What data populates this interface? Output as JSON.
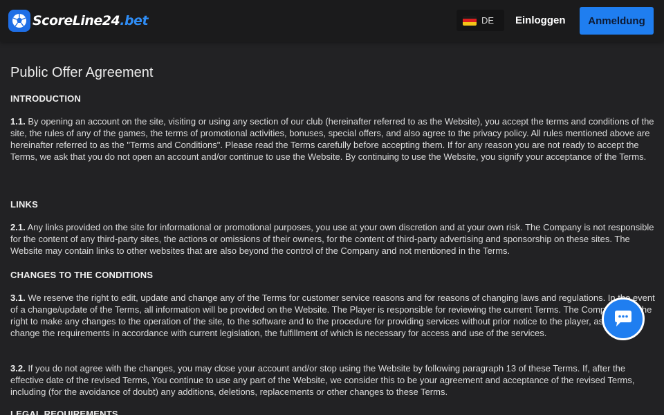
{
  "header": {
    "logo_text_main": "ScoreLine24",
    "logo_text_suffix": ".bet",
    "language_code": "DE",
    "login_label": "Einloggen",
    "register_label": "Anmeldung"
  },
  "colors": {
    "accent": "#1f7ef0",
    "background": "#222224",
    "header_background": "#1b1b1c"
  },
  "icons": {
    "logo": "soccer-ball-logo-icon",
    "flag": "germany-flag-icon",
    "chat": "chat-bubble-icon"
  },
  "main": {
    "title": "Public Offer Agreement",
    "sections": [
      {
        "heading": "INTRODUCTION",
        "paragraphs": [
          {
            "number": "1.1.",
            "text": "By opening an account on the site, visiting or using any section of our club (hereinafter referred to as the Website), you accept the terms and conditions of the site, the rules of any of the games, the terms of promotional activities, bonuses, special offers, and also agree to the privacy policy. All rules mentioned above are hereinafter referred to as the \"Terms and Conditions\". Please read the Terms carefully before accepting them. If for any reason you are not ready to accept the Terms, we ask that you do not open an account and/or continue to use the Website. By continuing to use the Website, you signify your acceptance of the Terms."
          }
        ]
      },
      {
        "heading": "LINKS",
        "paragraphs": [
          {
            "number": "2.1.",
            "text": "Any links provided on the site for informational or promotional purposes, you use at your own discretion and at your own risk. The Company is not responsible for the content of any third-party sites, the actions or omissions of their owners, for the content of third-party advertising and sponsorship on these sites. The Website may contain links to other websites that are also beyond the control of the Company and not mentioned in the Terms."
          }
        ]
      },
      {
        "heading": "CHANGES TO THE CONDITIONS",
        "paragraphs": [
          {
            "number": "3.1.",
            "text": "We reserve the right to edit, update and change any of the Terms for customer service reasons and for reasons of changing laws and regulations. In the event of a change/update of the Terms, all information will be provided on the Website. The Player is responsible for reviewing the current Terms. The Company has the right to make any changes to the operation of the site, to the software and to the procedure for providing services without prior notice to the player, as well as to change the requirements in accordance with current legislation, the fulfillment of which is necessary for access and use of the services."
          },
          {
            "number": "3.2.",
            "text": "If you do not agree with the changes, you may close your account and/or stop using the Website by following paragraph 13 of these Terms. If, after the effective date of the revised Terms, You continue to use any part of the Website, we consider this to be your agreement and acceptance of the revised Terms, including (for the avoidance of doubt) any additions, deletions, replacements or other changes to these Terms."
          }
        ]
      },
      {
        "heading": "LEGAL REQUIREMENTS",
        "paragraphs": []
      }
    ]
  }
}
